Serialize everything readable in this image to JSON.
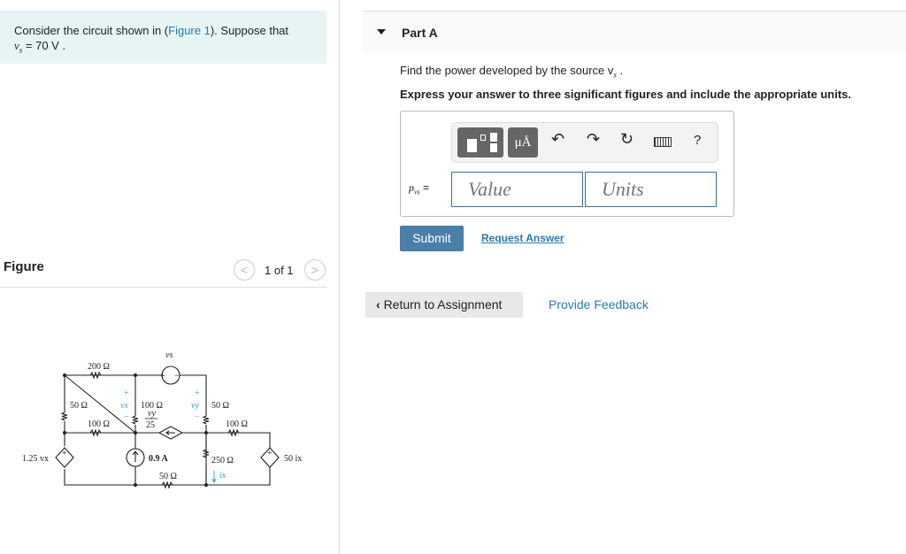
{
  "problem": {
    "text_before": "Consider the circuit shown in (",
    "figure_link": "Figure 1",
    "text_after": "). Suppose that",
    "vs_symbol": "v",
    "vs_sub": "s",
    "vs_value": " = 70 V ."
  },
  "figure": {
    "heading": "Figure",
    "pager": "1 of 1",
    "labels": {
      "r200": "200 Ω",
      "r50a": "50 Ω",
      "r100a": "100 Ω",
      "r100b": "100 Ω",
      "r50b": "50 Ω",
      "r100c": "100 Ω",
      "r250": "250 Ω",
      "r50c": "50 Ω",
      "vs": "vs",
      "vx": "vx",
      "vy": "vy",
      "dep_num": "vy",
      "dep_den": "25",
      "dep_left": "1.25 vx",
      "cur": "0.9 A",
      "dep_right": "50 ix",
      "ix": "ix",
      "plus": "+",
      "minus": "−"
    }
  },
  "part": {
    "title": "Part A",
    "question": "Find the power developed by the source v",
    "question_sub": "s",
    "question_end": " .",
    "instruction": "Express your answer to three significant figures and include the appropriate units.",
    "toolbar": {
      "units_btn": "μÅ",
      "help": "?"
    },
    "answer_label": "p",
    "answer_sub": "vs",
    "answer_eq": " =",
    "value_placeholder": "Value",
    "units_placeholder": "Units",
    "submit": "Submit",
    "request": "Request Answer"
  },
  "footer": {
    "return": "Return to Assignment",
    "feedback": "Provide Feedback"
  },
  "colors": {
    "accent": "#4a7fa8",
    "link": "#2a7ab0",
    "intro_bg": "#e6f4f4"
  }
}
